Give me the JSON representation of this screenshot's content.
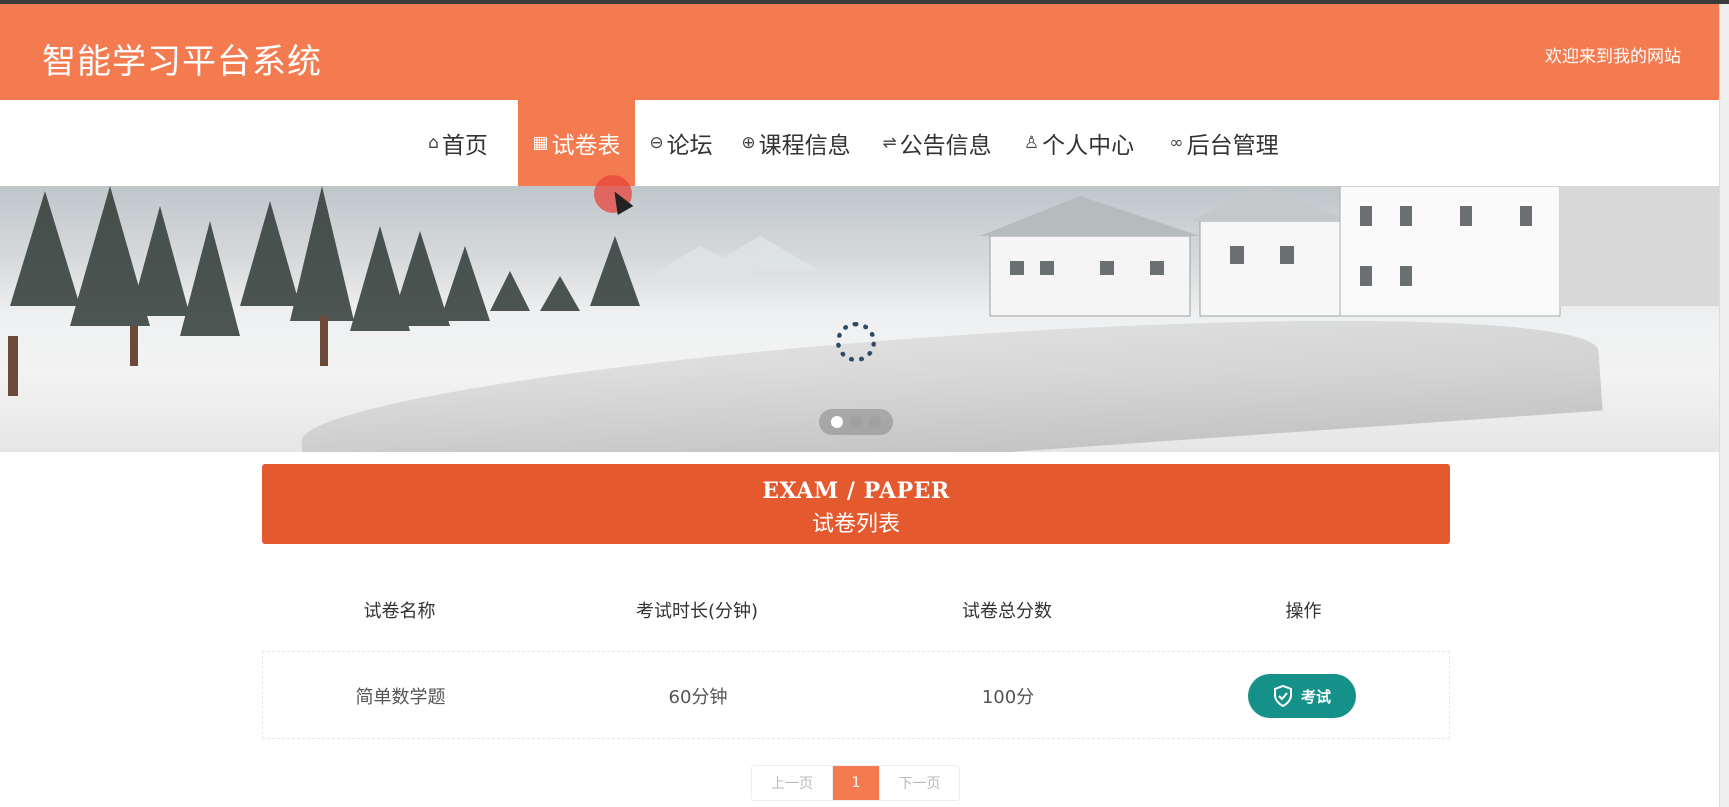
{
  "header": {
    "site_title": "智能学习平台系统",
    "welcome": "欢迎来到我的网站"
  },
  "nav": {
    "items": [
      {
        "icon": "home-icon",
        "label": "首页"
      },
      {
        "icon": "paper-icon",
        "label": "试卷表",
        "active": true
      },
      {
        "icon": "forum-icon",
        "label": "论坛"
      },
      {
        "icon": "globe-icon",
        "label": "课程信息"
      },
      {
        "icon": "sliders-icon",
        "label": "公告信息"
      },
      {
        "icon": "user-icon",
        "label": "个人中心"
      },
      {
        "icon": "link-icon",
        "label": "后台管理"
      }
    ]
  },
  "banner": {
    "slide_count": 3,
    "active_slide": 1,
    "loading": true
  },
  "section": {
    "title_en": "EXAM / PAPER",
    "title_cn": "试卷列表"
  },
  "table": {
    "columns": [
      "试卷名称",
      "考试时长(分钟)",
      "试卷总分数",
      "操作"
    ],
    "rows": [
      {
        "name": "简单数学题",
        "duration": "60分钟",
        "total": "100分",
        "action": "考试"
      }
    ]
  },
  "pagination": {
    "prev": "上一页",
    "current": "1",
    "next": "下一页"
  },
  "colors": {
    "primary": "#f47b50",
    "section": "#e5592f",
    "exam_button": "#15918a"
  }
}
